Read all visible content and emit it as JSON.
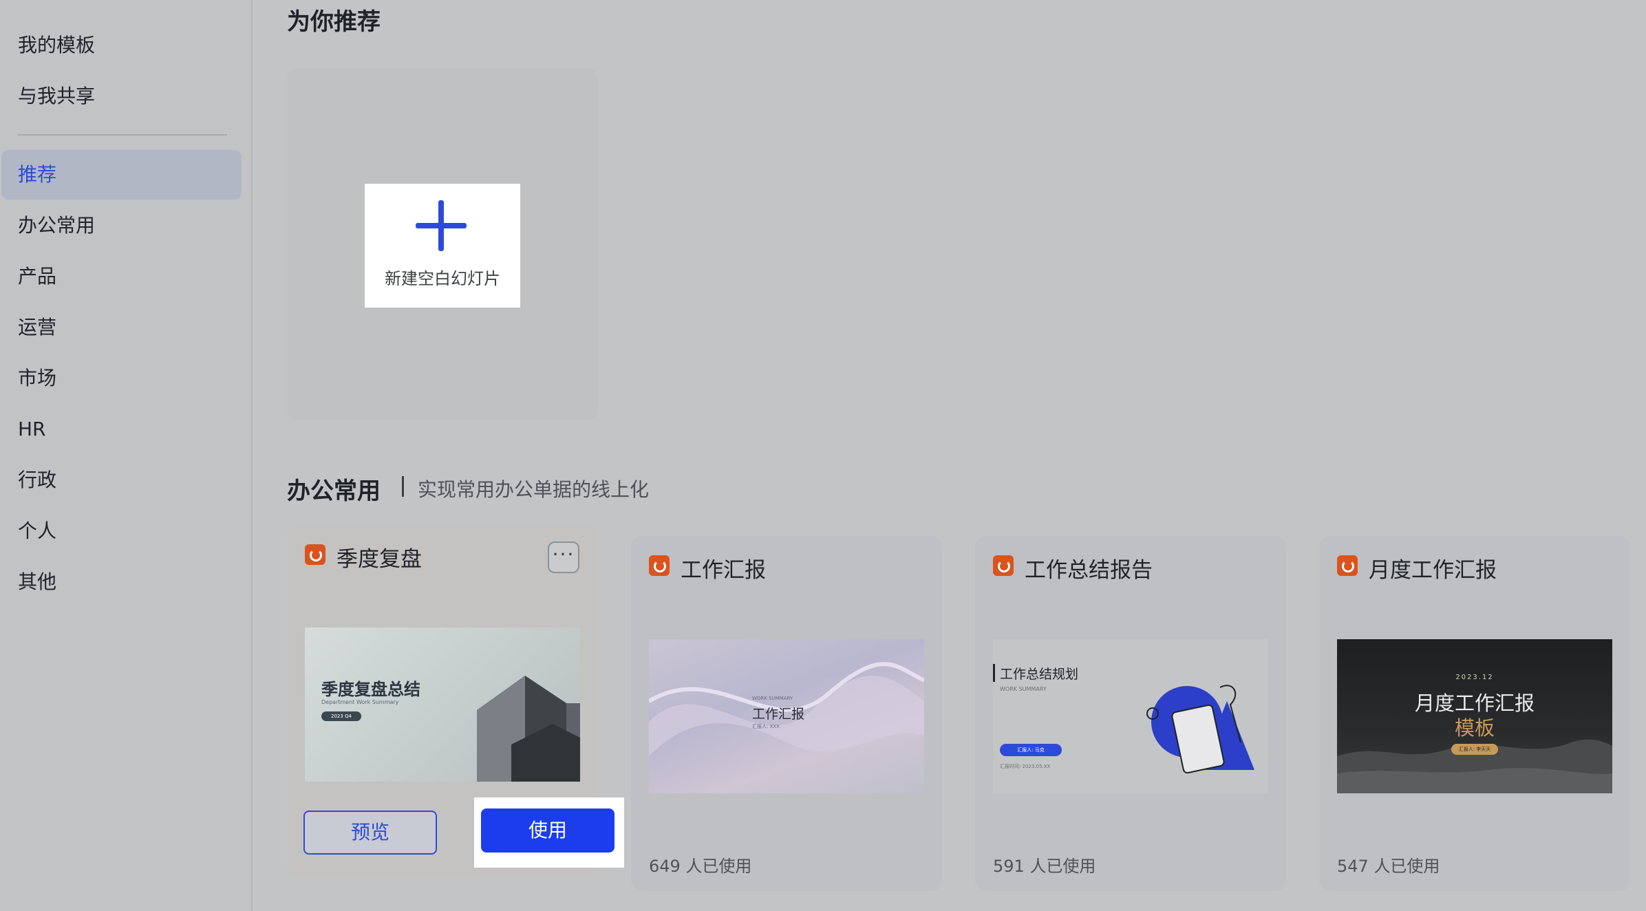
{
  "sidebar": {
    "items": [
      {
        "label": "我的模板"
      },
      {
        "label": "与我共享"
      },
      {
        "label": "推荐"
      },
      {
        "label": "办公常用"
      },
      {
        "label": "产品"
      },
      {
        "label": "运营"
      },
      {
        "label": "市场"
      },
      {
        "label": "HR"
      },
      {
        "label": "行政"
      },
      {
        "label": "个人"
      },
      {
        "label": "其他"
      }
    ],
    "active_index": 2
  },
  "recommend": {
    "title": "为你推荐",
    "new_blank_label": "新建空白幻灯片"
  },
  "office": {
    "title": "办公常用",
    "subtitle": "实现常用办公单据的线上化",
    "cards": [
      {
        "title": "季度复盘",
        "preview_label": "预览",
        "use_label": "使用",
        "thumb_title": "季度复盘总结",
        "thumb_sub": "Department Work Summary",
        "thumb_pill": "2023 Q4"
      },
      {
        "title": "工作汇报",
        "usage": "649 人已使用",
        "thumb_en": "WORK SUMMARY",
        "thumb_title": "工作汇报",
        "thumb_sub": "汇报人: XXX"
      },
      {
        "title": "工作总结报告",
        "usage": "591 人已使用",
        "thumb_title": "工作总结规划",
        "thumb_en": "WORK SUMMARY",
        "thumb_pill": "汇报人: 马克",
        "thumb_date": "汇报时间: 2023.05.XX"
      },
      {
        "title": "月度工作汇报",
        "usage": "547 人已使用",
        "thumb_date": "2023.12",
        "thumb_title": "月度工作汇报",
        "thumb_title2": "模板",
        "thumb_pill": "汇报人: 李天天"
      }
    ]
  },
  "colors": {
    "accent": "#2b4bd8",
    "use_button": "#1c3ded",
    "template_icon": "#d9541e"
  }
}
